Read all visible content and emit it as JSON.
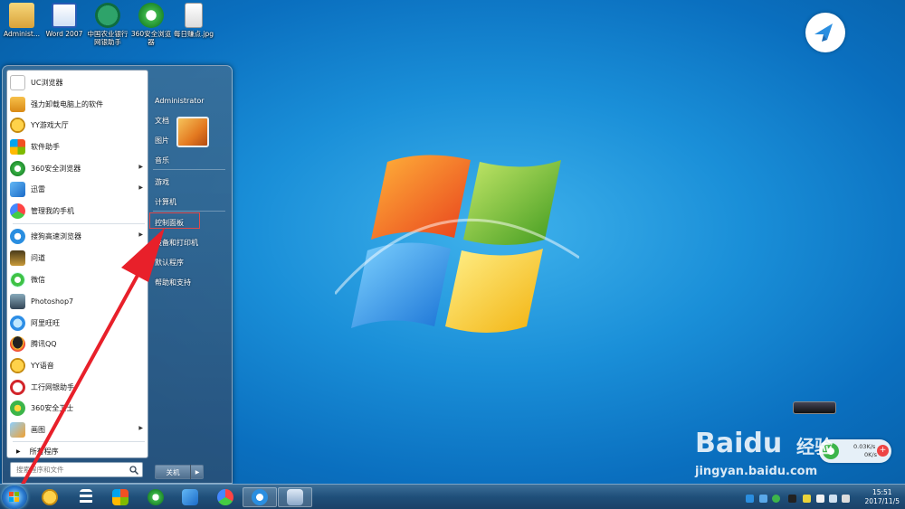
{
  "desktop": {
    "icons": [
      {
        "label": "Administ...",
        "icon": "folder-user-icon"
      },
      {
        "label": "Word 2007",
        "icon": "word-icon"
      },
      {
        "label": "中国农业银行网银助手",
        "icon": "abc-bank-icon"
      },
      {
        "label": "360安全浏览器",
        "icon": "360-browser-icon"
      },
      {
        "label": "每日赚点.jpg",
        "icon": "jpg-file-icon"
      }
    ]
  },
  "start_menu": {
    "left_items": [
      {
        "label": "UC浏览器",
        "icon": "uc-browser-icon",
        "arrow": false
      },
      {
        "label": "强力卸载电脑上的软件",
        "icon": "uninstall-icon",
        "arrow": false
      },
      {
        "label": "YY游戏大厅",
        "icon": "yy-game-icon",
        "arrow": false
      },
      {
        "label": "软件助手",
        "icon": "software-helper-icon",
        "arrow": false
      },
      {
        "label": "360安全浏览器",
        "icon": "360-browser-icon",
        "arrow": true
      },
      {
        "label": "迅雷",
        "icon": "thunder-icon",
        "arrow": true
      },
      {
        "label": "管理我的手机",
        "icon": "phone-manager-icon",
        "arrow": false
      },
      {
        "label": "搜狗高速浏览器",
        "icon": "sogou-browser-icon",
        "arrow": true
      },
      {
        "label": "问道",
        "icon": "wendao-icon",
        "arrow": false
      },
      {
        "label": "微信",
        "icon": "wechat-icon",
        "arrow": false
      },
      {
        "label": "Photoshop7",
        "icon": "photoshop-icon",
        "arrow": false
      },
      {
        "label": "阿里旺旺",
        "icon": "aliwangwang-icon",
        "arrow": false
      },
      {
        "label": "腾讯QQ",
        "icon": "qq-icon",
        "arrow": false
      },
      {
        "label": "YY语音",
        "icon": "yy-voice-icon",
        "arrow": false
      },
      {
        "label": "工行网银助手",
        "icon": "icbc-icon",
        "arrow": false
      },
      {
        "label": "360安全卫士",
        "icon": "360-guard-icon",
        "arrow": false
      },
      {
        "label": "画图",
        "icon": "paint-icon",
        "arrow": true
      }
    ],
    "all_programs": "所有程序",
    "search_placeholder": "搜索程序和文件",
    "right_items": [
      {
        "label": "Administrator"
      },
      {
        "label": "文档"
      },
      {
        "label": "图片"
      },
      {
        "label": "音乐"
      },
      {
        "label": "游戏"
      },
      {
        "label": "计算机"
      },
      {
        "label": "控制面板"
      },
      {
        "label": "设备和打印机"
      },
      {
        "label": "默认程序"
      },
      {
        "label": "帮助和支持"
      }
    ],
    "shutdown_label": "关机"
  },
  "overlay": {
    "tray_speed_up": "0.03K/s",
    "tray_speed_down": "0K/s",
    "watermark_brand": "Baidu",
    "watermark_sub": "经验",
    "watermark_url": "jingyan.baidu.com"
  },
  "taskbar": {
    "clock_time": "15:51",
    "clock_date": "2017/11/5"
  },
  "colors": {
    "highlight": "#e24a4a",
    "arrow": "#e8202a"
  }
}
